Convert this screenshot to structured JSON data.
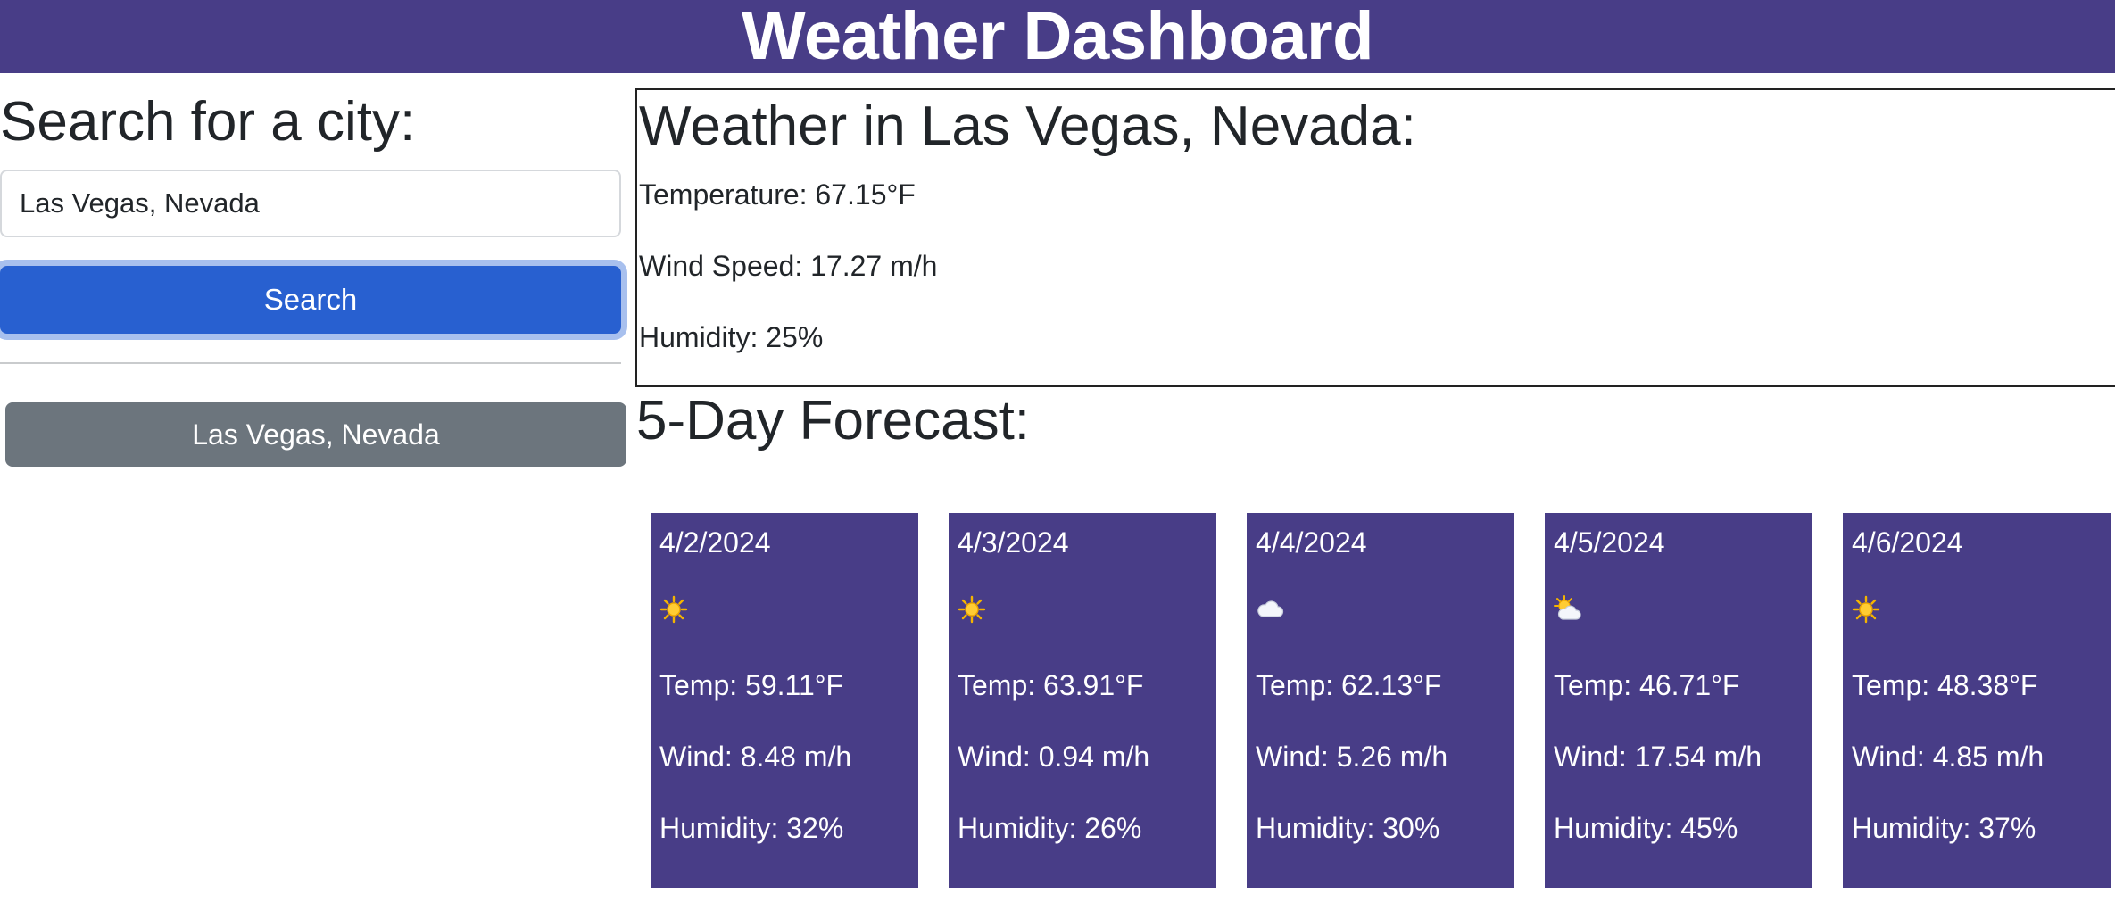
{
  "header": {
    "title": "Weather Dashboard"
  },
  "sidebar": {
    "heading": "Search for a city:",
    "input_value": "Las Vegas, Nevada",
    "search_label": "Search",
    "history": [
      "Las Vegas, Nevada"
    ]
  },
  "current": {
    "heading": "Weather in Las Vegas, Nevada:",
    "temperature": "Temperature: 67.15°F",
    "wind": "Wind Speed: 17.27 m/h",
    "humidity": "Humidity: 25%"
  },
  "forecast": {
    "heading": "5-Day Forecast:",
    "days": [
      {
        "date": "4/2/2024",
        "icon": "sun-icon",
        "temp": "Temp: 59.11°F",
        "wind": "Wind: 8.48 m/h",
        "humidity": "Humidity: 32%"
      },
      {
        "date": "4/3/2024",
        "icon": "sun-icon",
        "temp": "Temp: 63.91°F",
        "wind": "Wind: 0.94 m/h",
        "humidity": "Humidity: 26%"
      },
      {
        "date": "4/4/2024",
        "icon": "cloud-icon",
        "temp": "Temp: 62.13°F",
        "wind": "Wind: 5.26 m/h",
        "humidity": "Humidity: 30%"
      },
      {
        "date": "4/5/2024",
        "icon": "sun-behind-cloud-icon",
        "temp": "Temp: 46.71°F",
        "wind": "Wind: 17.54 m/h",
        "humidity": "Humidity: 45%"
      },
      {
        "date": "4/6/2024",
        "icon": "sun-icon",
        "temp": "Temp: 48.38°F",
        "wind": "Wind: 4.85 m/h",
        "humidity": "Humidity: 37%"
      }
    ]
  },
  "colors": {
    "header_bg": "#483d87",
    "card_bg": "#483d87",
    "search_button": "#2860d0",
    "history_button": "#6c757d"
  }
}
